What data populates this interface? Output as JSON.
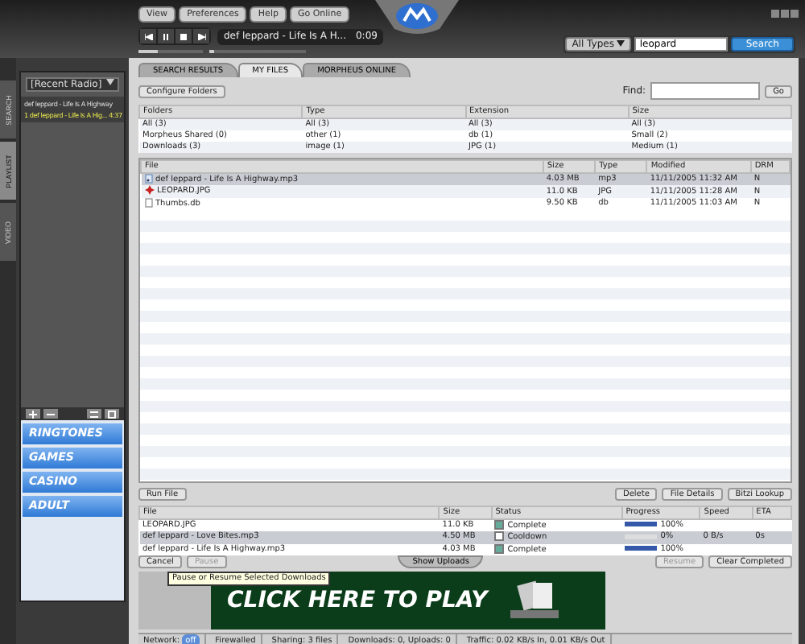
{
  "menu": [
    "View",
    "Preferences",
    "Help"
  ],
  "online_button": "Go Online",
  "player": {
    "track": "def leppard - Life Is A H...",
    "time": "0:09",
    "volume": {
      "level": 0.3
    },
    "seek": {
      "level": 0.05
    }
  },
  "search": {
    "type": "All Types",
    "query": "leopard",
    "button": "Search"
  },
  "side_tabs": [
    {
      "label": "SEARCH",
      "selected": false
    },
    {
      "label": "PLAYLIST",
      "selected": true
    },
    {
      "label": "VIDEO",
      "selected": false
    }
  ],
  "playlist": {
    "source": "[Recent Radio]",
    "items": [
      {
        "title": "def leppard - Life Is A Highway",
        "selected": false
      },
      {
        "title": "1  def leppard - Life Is A Hig... 4:37",
        "selected": true
      }
    ]
  },
  "links": [
    "RINGTONES",
    "GAMES",
    "CASINO",
    "ADULT"
  ],
  "tabs": [
    {
      "label": "SEARCH RESULTS",
      "selected": false
    },
    {
      "label": "MY FILES",
      "selected": true
    },
    {
      "label": "MORPHEUS ONLINE",
      "selected": false
    }
  ],
  "configure_button": "Configure Folders",
  "find_label": "Find:",
  "go_button": "Go",
  "filters": {
    "columns": [
      "Folders",
      "Type",
      "Extension",
      "Size"
    ],
    "rows": [
      [
        "All (3)",
        "All (3)",
        "All (3)",
        "All (3)"
      ],
      [
        "Morpheus Shared (0)",
        "other (1)",
        "db (1)",
        "Small (2)"
      ],
      [
        "Downloads (3)",
        "image (1)",
        "JPG (1)",
        "Medium (1)"
      ]
    ]
  },
  "files": {
    "columns": [
      "File",
      "Size",
      "Type",
      "Modified",
      "DRM"
    ],
    "rows": [
      {
        "kind": "audio",
        "cells": [
          "def leppard - Life Is A Highway.mp3",
          "4.03 MB",
          "mp3",
          "11/11/2005 11:32 AM",
          "N"
        ],
        "selected": true
      },
      {
        "kind": "image",
        "cells": [
          "LEOPARD.JPG",
          "11.0 KB",
          "JPG",
          "11/11/2005 11:28 AM",
          "N"
        ],
        "selected": false
      },
      {
        "kind": "file",
        "cells": [
          "Thumbs.db",
          "9.50 KB",
          "db",
          "11/11/2005 11:03 AM",
          "N"
        ],
        "selected": false
      }
    ]
  },
  "file_buttons": [
    "Run File",
    "Delete",
    "File Details",
    "Bitzi Lookup"
  ],
  "downloads": {
    "columns": [
      "File",
      "Size",
      "Status",
      "Progress",
      "Speed",
      "ETA"
    ],
    "rows": [
      {
        "file": "LEOPARD.JPG",
        "size": "11.0 KB",
        "status": "Complete",
        "complete": true,
        "level": 1,
        "percent": "100%",
        "selected": false
      },
      {
        "file": "def leppard - Love Bites.mp3",
        "size": "4.50 MB",
        "status": "Cooldown",
        "complete": false,
        "level": 0,
        "percent": "0%",
        "speed": "0 B/s",
        "eta": "0s",
        "selected": true
      },
      {
        "file": "def leppard - Life Is A Highway.mp3",
        "size": "4.03 MB",
        "status": "Complete",
        "complete": true,
        "level": 1,
        "percent": "100%",
        "selected": false
      }
    ]
  },
  "download_buttons": [
    {
      "label": "Cancel",
      "disabled": false
    },
    {
      "label": "Pause",
      "disabled": true
    }
  ],
  "show_uploads": "Show Uploads",
  "right_buttons": [
    {
      "label": "Resume",
      "disabled": true
    },
    {
      "label": "Clear Completed",
      "disabled": false
    }
  ],
  "tooltip": "Pause or Resume Selected Downloads",
  "ad": {
    "headline": "CLICK HERE TO PLAY"
  },
  "status_bar": {
    "network_label": "Network:",
    "network": "off",
    "items": [
      "Firewalled",
      "Sharing: 3 files",
      "Downloads: 0, Uploads: 0",
      "Traffic: 0.02 KB/s In, 0.01 KB/s Out"
    ]
  }
}
